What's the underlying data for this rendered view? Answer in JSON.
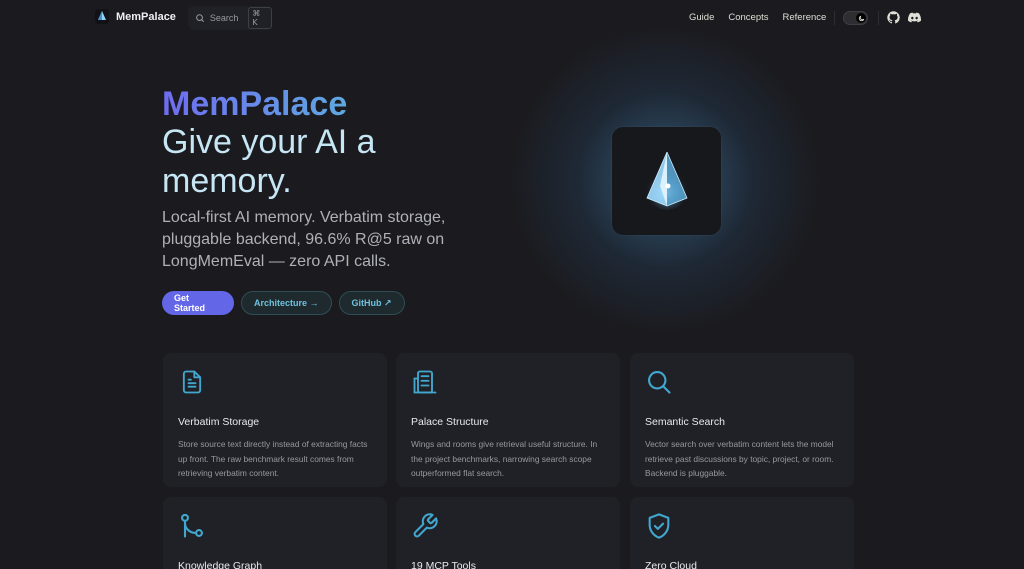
{
  "nav": {
    "brand": "MemPalace",
    "search_label": "Search",
    "search_shortcut": "⌘ K",
    "links": [
      {
        "label": "Guide"
      },
      {
        "label": "Concepts"
      },
      {
        "label": "Reference"
      }
    ],
    "icons": [
      "moon-icon",
      "github-icon",
      "discord-icon"
    ]
  },
  "hero": {
    "name": "MemPalace",
    "text": "Give your AI a memory.",
    "tagline": "Local-first AI memory. Verbatim storage, pluggable backend, 96.6% R@5 raw on LongMemEval — zero API calls.",
    "actions": [
      {
        "label": "Get Started"
      },
      {
        "label": "Architecture →"
      },
      {
        "label": "GitHub ↗"
      }
    ]
  },
  "features": [
    {
      "icon": "document-icon",
      "title": "Verbatim Storage",
      "desc": "Store source text directly instead of extracting facts up front. The raw benchmark result comes from retrieving verbatim content."
    },
    {
      "icon": "building-icon",
      "title": "Palace Structure",
      "desc": "Wings and rooms give retrieval useful structure. In the project benchmarks, narrowing search scope outperformed flat search."
    },
    {
      "icon": "search-icon",
      "title": "Semantic Search",
      "desc": "Vector search over verbatim content lets the model retrieve past discussions by topic, project, or room. Backend is pluggable."
    },
    {
      "icon": "git-branch-icon",
      "title": "Knowledge Graph",
      "desc": ""
    },
    {
      "icon": "wrench-icon",
      "title": "19 MCP Tools",
      "desc": ""
    },
    {
      "icon": "shield-check-icon",
      "title": "Zero Cloud",
      "desc": ""
    }
  ],
  "colors": {
    "background": "#1b1b1f",
    "accent": "#6366e6",
    "icon": "#41a7cf",
    "card": "#202127"
  }
}
